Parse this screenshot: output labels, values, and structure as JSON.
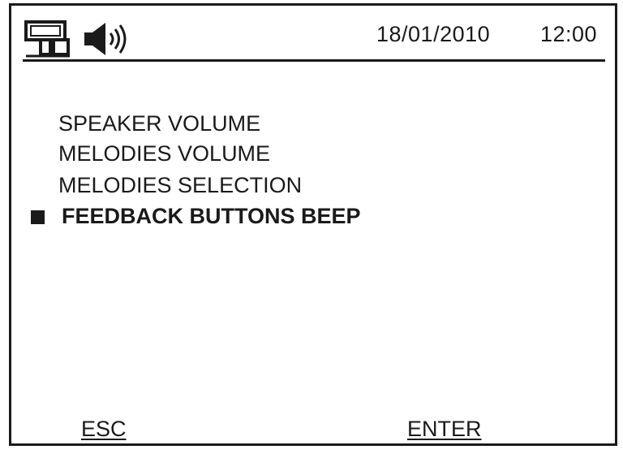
{
  "status_bar": {
    "network_icon": "network-icon",
    "speaker_icon": "speaker-volume-icon",
    "date": "18/01/2010",
    "time": "12:00"
  },
  "menu": {
    "items": [
      {
        "label": "SPEAKER VOLUME",
        "selected": false
      },
      {
        "label": "MELODIES VOLUME",
        "selected": false
      },
      {
        "label": "MELODIES SELECTION",
        "selected": false
      },
      {
        "label": "FEEDBACK BUTTONS BEEP",
        "selected": true
      }
    ]
  },
  "softkeys": {
    "left": "ESC",
    "right": "ENTER"
  }
}
